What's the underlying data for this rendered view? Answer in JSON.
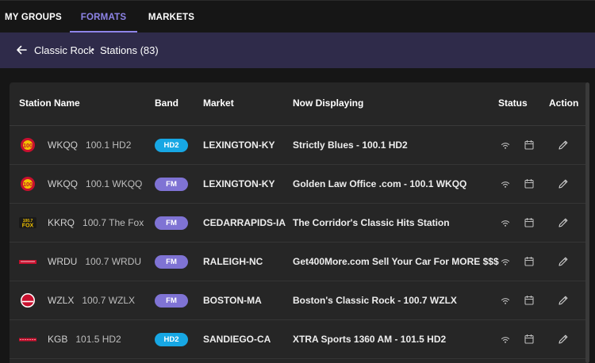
{
  "nav": {
    "tabs": [
      {
        "label": "MY GROUPS",
        "active": false
      },
      {
        "label": "FORMATS",
        "active": true
      },
      {
        "label": "MARKETS",
        "active": false
      }
    ]
  },
  "header": {
    "crumb": "Classic Rock",
    "separator": "•",
    "title": "Stations (83)"
  },
  "table": {
    "columns": [
      "Station Name",
      "Band",
      "Market",
      "Now Displaying",
      "Status",
      "Action"
    ],
    "rows": [
      {
        "callsign": "WKQQ",
        "freq": "100.1 HD2",
        "band": "HD2",
        "market": "LEXINGTON-KY",
        "now": "Strictly Blues - 100.1 HD2"
      },
      {
        "callsign": "WKQQ",
        "freq": "100.1 WKQQ",
        "band": "FM",
        "market": "LEXINGTON-KY",
        "now": "Golden Law Office .com - 100.1 WKQQ"
      },
      {
        "callsign": "KKRQ",
        "freq": "100.7 The Fox",
        "band": "FM",
        "market": "CEDARRAPIDS-IA",
        "now": "The Corridor's Classic Hits Station"
      },
      {
        "callsign": "WRDU",
        "freq": "100.7 WRDU",
        "band": "FM",
        "market": "RALEIGH-NC",
        "now": "Get400More.com Sell Your Car For MORE $$$"
      },
      {
        "callsign": "WZLX",
        "freq": "100.7 WZLX",
        "band": "FM",
        "market": "BOSTON-MA",
        "now": "Boston's Classic Rock - 100.7 WZLX"
      },
      {
        "callsign": "KGB",
        "freq": "101.5 HD2",
        "band": "HD2",
        "market": "SANDIEGO-CA",
        "now": "XTRA Sports 1360 AM - 101.5 HD2"
      }
    ]
  },
  "colors": {
    "accent": "#8e84e8",
    "header_bg": "#2f2b4a",
    "band_hd2": "#17a7e4",
    "band_fm": "#7f73d4"
  },
  "icons": [
    "arrow-left-icon",
    "station-logo-icon",
    "wifi-icon",
    "calendar-icon",
    "pencil-icon"
  ]
}
